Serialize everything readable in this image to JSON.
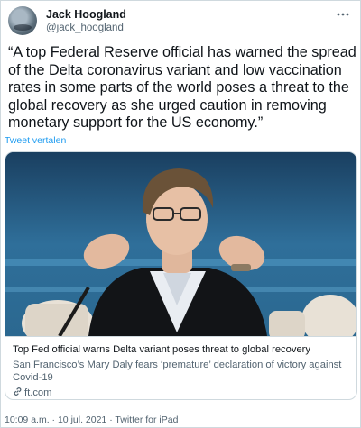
{
  "author": {
    "name": "Jack Hoogland",
    "handle": "@jack_hoogland"
  },
  "tweet": {
    "text": "“A top Federal Reserve official has warned the spread of the Delta coronavirus variant and low vaccination rates in some parts of the world poses a threat to the global recovery as she urged caution in removing monetary support for the US economy.”",
    "translate_label": "Tweet vertalen"
  },
  "card": {
    "title": "Top Fed official warns Delta variant poses threat to global recovery",
    "description": "San Francisco’s Mary Daly fears ‘premature’ declaration of victory against Covid-19",
    "domain": "ft.com"
  },
  "meta": {
    "time": "10:09 a.m.",
    "separator": "·",
    "date": "10 jul. 2021",
    "source": "Twitter for iPad"
  },
  "icons": {
    "more": "more-icon",
    "link": "link-icon"
  },
  "colors": {
    "link_blue": "#1d9bf0",
    "secondary_text": "#536471",
    "border": "#cfd9de"
  }
}
